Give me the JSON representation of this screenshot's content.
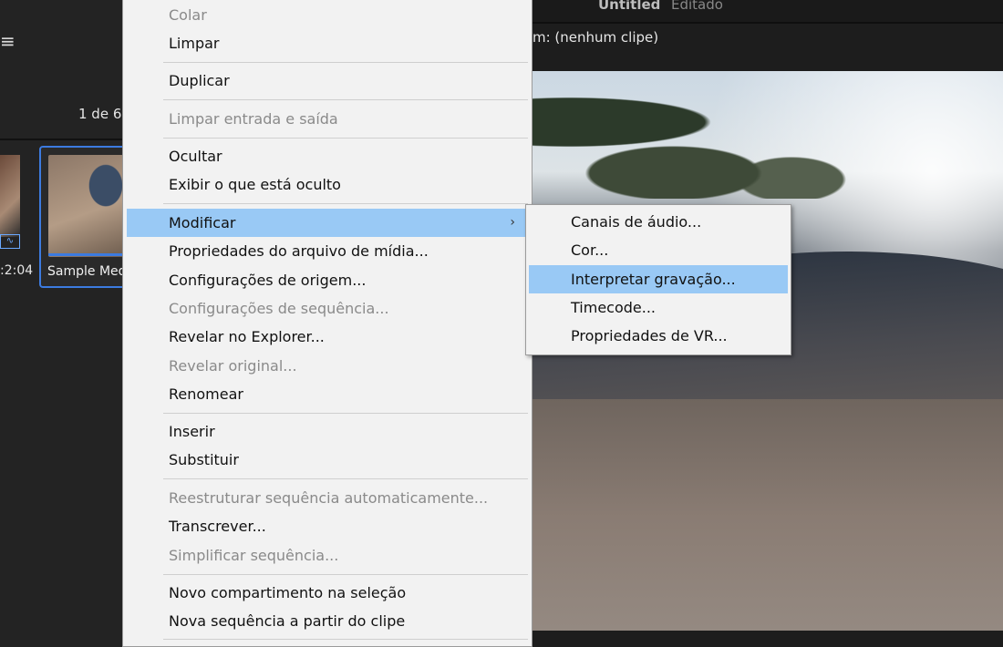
{
  "background": {
    "doc_title": "Untitled",
    "doc_state": "Editado",
    "source_label": "m: (nenhum clipe)",
    "pager": "1 de 6",
    "left_duration": ":2:04",
    "clip_name": "Sample Med"
  },
  "context_menu": {
    "items": [
      {
        "label": "Colar",
        "disabled": true
      },
      {
        "label": "Limpar",
        "disabled": false
      },
      {
        "label": "Duplicar",
        "disabled": false
      },
      {
        "label": "Limpar entrada e saída",
        "disabled": true
      },
      {
        "label": "Ocultar",
        "disabled": false
      },
      {
        "label": "Exibir o que está oculto",
        "disabled": false
      },
      {
        "label": "Modificar",
        "disabled": false,
        "highlighted": true,
        "submenu": true
      },
      {
        "label": "Propriedades do arquivo de mídia...",
        "disabled": false
      },
      {
        "label": "Configurações de origem...",
        "disabled": false
      },
      {
        "label": "Configurações de sequência...",
        "disabled": true
      },
      {
        "label": "Revelar no Explorer...",
        "disabled": false
      },
      {
        "label": "Revelar original...",
        "disabled": true
      },
      {
        "label": "Renomear",
        "disabled": false
      },
      {
        "label": "Inserir",
        "disabled": false
      },
      {
        "label": "Substituir",
        "disabled": false
      },
      {
        "label": "Reestruturar sequência automaticamente...",
        "disabled": true
      },
      {
        "label": "Transcrever...",
        "disabled": false
      },
      {
        "label": "Simplificar sequência...",
        "disabled": true
      },
      {
        "label": "Novo compartimento na seleção",
        "disabled": false
      },
      {
        "label": "Nova sequência a partir do clipe",
        "disabled": false
      }
    ],
    "submenu_arrow": "›"
  },
  "submenu": {
    "items": [
      {
        "label": "Canais de áudio..."
      },
      {
        "label": "Cor..."
      },
      {
        "label": "Interpretar gravação...",
        "highlighted": true
      },
      {
        "label": "Timecode..."
      },
      {
        "label": "Propriedades de VR..."
      }
    ]
  },
  "colors": {
    "highlight": "#99c9f5",
    "menu_bg": "#f2f2f2",
    "selection_border": "#3c7be0"
  },
  "icons": {
    "hamburger": "hamburger-menu-icon",
    "audio_wave": "audio-waveform-icon",
    "submenu": "chevron-right-icon"
  }
}
